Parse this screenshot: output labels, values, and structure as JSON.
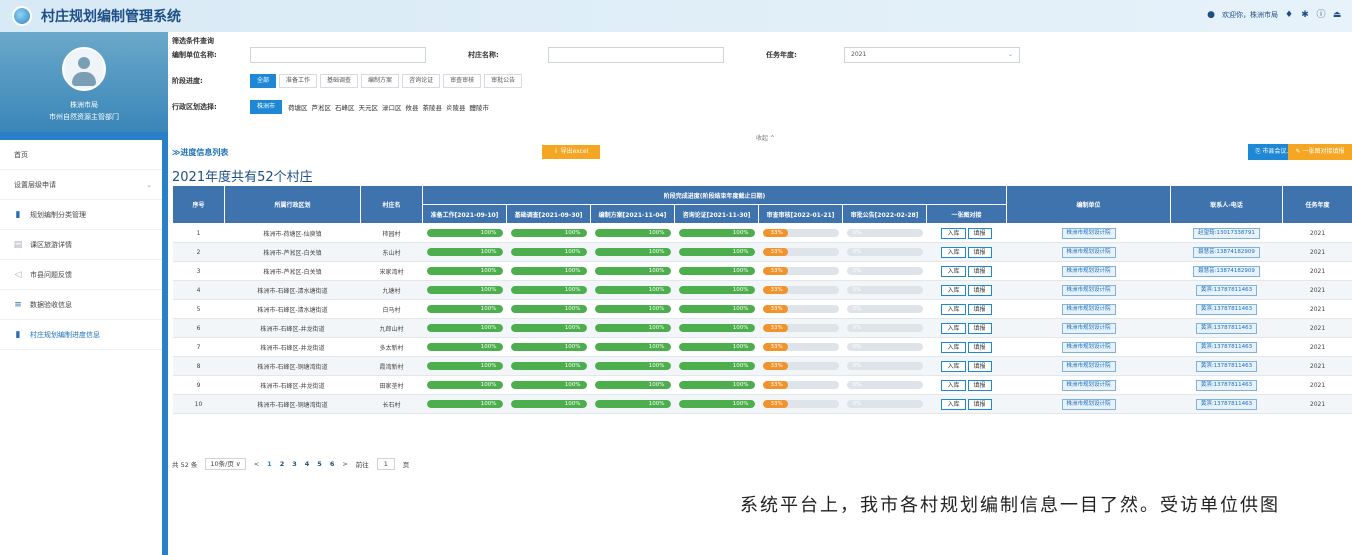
{
  "app": {
    "title": "村庄规划编制管理系统"
  },
  "topbar": {
    "welcome": "欢迎你，株洲市局"
  },
  "sidebar": {
    "org_line1": "株洲市局",
    "org_line2": "市州自然资源主管部门",
    "items": [
      {
        "label": "首页",
        "icon": ""
      },
      {
        "label": "设置层级申请",
        "icon": ""
      },
      {
        "label": "规划编制分类管理",
        "icon": "chart-icon"
      },
      {
        "label": "课区旅游详情",
        "icon": "doc-icon"
      },
      {
        "label": "市县问题反馈",
        "icon": "send-icon"
      },
      {
        "label": "数据验收信息",
        "icon": "list-icon"
      },
      {
        "label": "村庄规划编制进度信息",
        "icon": "chart-icon"
      }
    ]
  },
  "filters": {
    "title": "筛选条件查询",
    "unit_label": "编制单位名称:",
    "unit_value": "",
    "village_label": "村庄名称:",
    "village_value": "",
    "year_label": "任务年度:",
    "year_value": "2021",
    "stage_label": "阶段进度:",
    "stages": [
      "全部",
      "准备工作",
      "基础调查",
      "编制方案",
      "咨询论证",
      "审查审核",
      "审批公告"
    ],
    "district_label": "行政区划选择:",
    "districts": [
      "株洲市",
      "荷塘区",
      "芦淞区",
      "石峰区",
      "天元区",
      "渌口区",
      "攸县",
      "茶陵县",
      "炎陵县",
      "醴陵市"
    ],
    "collapse": "收起 ^"
  },
  "section": {
    "title": "≫进度信息列表",
    "export": "⇩ 导出excel",
    "upload": "⎘ 市县会议上传",
    "fill": "✎ 一张图对接填报"
  },
  "summary": "2021年度共有52个村庄",
  "table": {
    "headers": {
      "no": "序号",
      "district": "所属行政区划",
      "village": "村庄名",
      "group": "阶段完成进度(阶段结束年度截止日期)",
      "unit": "编制单位",
      "contact": "联系人-电话",
      "year": "任务年度"
    },
    "stage_headers": [
      "准备工作[2021-09-10]",
      "基础调查[2021-09-30]",
      "编制方案[2021-11-04]",
      "咨询论证[2021-11-30]",
      "审查审核[2022-01-21]",
      "审批公告[2022-02-28]",
      "一张图对接"
    ],
    "actions": [
      "入库",
      "填报"
    ],
    "rows": [
      {
        "no": "1",
        "district": "株洲市-荷塘区-仙庾镇",
        "village": "柿园村",
        "unit": "株洲市规划设计院",
        "contact": "赵望筠:13017338791",
        "year": "2021",
        "progress": [
          100,
          100,
          100,
          100,
          33,
          0
        ]
      },
      {
        "no": "2",
        "district": "株洲市-芦淞区-白关镇",
        "village": "东山村",
        "unit": "株洲市规划设计院",
        "contact": "聂慧芸:13874182909",
        "year": "2021",
        "progress": [
          100,
          100,
          100,
          100,
          33,
          0
        ]
      },
      {
        "no": "3",
        "district": "株洲市-芦淞区-白关镇",
        "village": "宋家湾村",
        "unit": "株洲市规划设计院",
        "contact": "聂慧芸:13874182909",
        "year": "2021",
        "progress": [
          100,
          100,
          100,
          100,
          33,
          0
        ]
      },
      {
        "no": "4",
        "district": "株洲市-石峰区-清水塘街道",
        "village": "九塘村",
        "unit": "株洲市规划设计院",
        "contact": "黄滨:13787811463",
        "year": "2021",
        "progress": [
          100,
          100,
          100,
          100,
          33,
          0
        ]
      },
      {
        "no": "5",
        "district": "株洲市-石峰区-清水塘街道",
        "village": "白马村",
        "unit": "株洲市规划设计院",
        "contact": "黄滨:13787811463",
        "year": "2021",
        "progress": [
          100,
          100,
          100,
          100,
          33,
          0
        ]
      },
      {
        "no": "6",
        "district": "株洲市-石峰区-井龙街道",
        "village": "九郎山村",
        "unit": "株洲市规划设计院",
        "contact": "黄滨:13787811463",
        "year": "2021",
        "progress": [
          100,
          100,
          100,
          100,
          33,
          0
        ]
      },
      {
        "no": "7",
        "district": "株洲市-石峰区-井龙街道",
        "village": "多太新村",
        "unit": "株洲市规划设计院",
        "contact": "黄滨:13787811463",
        "year": "2021",
        "progress": [
          100,
          100,
          100,
          100,
          33,
          0
        ]
      },
      {
        "no": "8",
        "district": "株洲市-石峰区-铜塘湾街道",
        "village": "霞湾新村",
        "unit": "株洲市规划设计院",
        "contact": "黄滨:13787811463",
        "year": "2021",
        "progress": [
          100,
          100,
          100,
          100,
          33,
          0
        ]
      },
      {
        "no": "9",
        "district": "株洲市-石峰区-井龙街道",
        "village": "田家垄村",
        "unit": "株洲市规划设计院",
        "contact": "黄滨:13787811463",
        "year": "2021",
        "progress": [
          100,
          100,
          100,
          100,
          33,
          0
        ]
      },
      {
        "no": "10",
        "district": "株洲市-石峰区-铜塘湾街道",
        "village": "长石村",
        "unit": "株洲市规划设计院",
        "contact": "黄滨:13787811463",
        "year": "2021",
        "progress": [
          100,
          100,
          100,
          100,
          33,
          0
        ]
      }
    ]
  },
  "pager": {
    "total": "共 52 条",
    "size": "10条/页 ∨",
    "prev": "<",
    "pages": [
      "1",
      "2",
      "3",
      "4",
      "5",
      "6"
    ],
    "next": ">",
    "goto": "前往",
    "page_input": "1",
    "page_unit": "页"
  },
  "caption": "系统平台上，我市各村规划编制信息一目了然。受访单位供图",
  "colors": {
    "green": "#4cae4c",
    "orange": "#f0932b",
    "header": "#3f73ad",
    "accent": "#1e88d6"
  }
}
